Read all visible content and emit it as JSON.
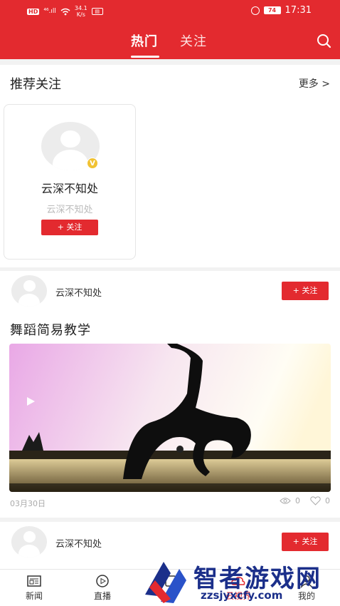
{
  "status_bar": {
    "hd": "HD",
    "signal": "⁴⁶.ıll",
    "speed_value": "34.1",
    "speed_unit": "K/s",
    "battery": "74",
    "time": "17:31"
  },
  "header": {
    "tabs": [
      {
        "label": "热门",
        "active": true
      },
      {
        "label": "关注",
        "active": false
      }
    ],
    "search_icon": "search-icon",
    "accent_color": "#e32a2f"
  },
  "recommend": {
    "title": "推荐关注",
    "more_label": "更多 >",
    "cards": [
      {
        "name": "云深不知处",
        "subtitle": "云深不知处",
        "follow_label": "+ 关注",
        "badge": "V"
      }
    ]
  },
  "feed": [
    {
      "author": "云深不知处",
      "follow_label": "+ 关注",
      "title": "舞蹈简易教学",
      "date": "03月30日",
      "views": "0",
      "likes": "0"
    },
    {
      "author": "云深不知处",
      "follow_label": "+ 关注"
    }
  ],
  "bottom_nav": [
    {
      "label": "新闻",
      "icon": "news-icon"
    },
    {
      "label": "直播",
      "icon": "live-icon"
    },
    {
      "label": "号",
      "icon": "account-icon"
    },
    {
      "label": "云视界",
      "icon": "cloud-icon"
    },
    {
      "label": "我的",
      "icon": "profile-icon"
    }
  ],
  "watermark": {
    "title": "智者游戏网",
    "url": "zzsjyxcfy.com"
  }
}
